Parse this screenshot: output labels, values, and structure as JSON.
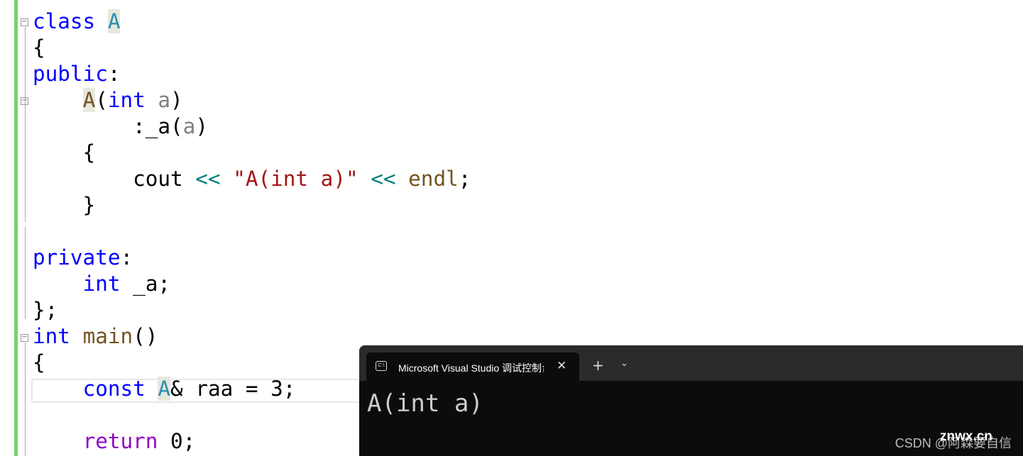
{
  "editor": {
    "lines": [
      [
        {
          "t": "class ",
          "c": "kw"
        },
        {
          "t": "A",
          "c": "ty hl"
        }
      ],
      [
        {
          "t": "{",
          "c": ""
        }
      ],
      [
        {
          "t": "public",
          "c": "kw"
        },
        {
          "t": ":",
          "c": ""
        }
      ],
      [
        {
          "t": "    ",
          "c": ""
        },
        {
          "t": "A",
          "c": "fn hl"
        },
        {
          "t": "(",
          "c": ""
        },
        {
          "t": "int",
          "c": "kw"
        },
        {
          "t": " ",
          "c": ""
        },
        {
          "t": "a",
          "c": "pa"
        },
        {
          "t": ")",
          "c": ""
        }
      ],
      [
        {
          "t": "        :_a(",
          "c": ""
        },
        {
          "t": "a",
          "c": "pa"
        },
        {
          "t": ")",
          "c": ""
        }
      ],
      [
        {
          "t": "    {",
          "c": ""
        }
      ],
      [
        {
          "t": "        cout ",
          "c": ""
        },
        {
          "t": "<<",
          "c": "op"
        },
        {
          "t": " ",
          "c": ""
        },
        {
          "t": "\"A(int a)\"",
          "c": "st"
        },
        {
          "t": " ",
          "c": ""
        },
        {
          "t": "<<",
          "c": "op"
        },
        {
          "t": " ",
          "c": ""
        },
        {
          "t": "endl",
          "c": "fn"
        },
        {
          "t": ";",
          "c": ""
        }
      ],
      [
        {
          "t": "    }",
          "c": ""
        }
      ],
      [
        {
          "t": "",
          "c": ""
        }
      ],
      [
        {
          "t": "private",
          "c": "kw"
        },
        {
          "t": ":",
          "c": ""
        }
      ],
      [
        {
          "t": "    ",
          "c": ""
        },
        {
          "t": "int",
          "c": "kw"
        },
        {
          "t": " _a;",
          "c": ""
        }
      ],
      [
        {
          "t": "};",
          "c": ""
        }
      ],
      [
        {
          "t": "int",
          "c": "kw"
        },
        {
          "t": " ",
          "c": ""
        },
        {
          "t": "main",
          "c": "fn"
        },
        {
          "t": "()",
          "c": ""
        }
      ],
      [
        {
          "t": "{",
          "c": ""
        }
      ],
      [
        {
          "t": "    ",
          "c": ""
        },
        {
          "t": "const",
          "c": "kw"
        },
        {
          "t": " ",
          "c": ""
        },
        {
          "t": "A",
          "c": "ty hl"
        },
        {
          "t": "& raa = 3;",
          "c": ""
        }
      ],
      [
        {
          "t": "",
          "c": ""
        }
      ],
      [
        {
          "t": "    ",
          "c": ""
        },
        {
          "t": "return",
          "c": "pu"
        },
        {
          "t": " 0;",
          "c": ""
        }
      ]
    ]
  },
  "terminal": {
    "tab_title": "Microsoft Visual Studio 调试控制台",
    "tab_icon": "C:\\",
    "close": "✕",
    "new_tab": "+",
    "dropdown": "⌄",
    "output": "A(int a)"
  },
  "watermark": {
    "csdn": "CSDN @阿森要自信",
    "site": "znwx.cn"
  }
}
